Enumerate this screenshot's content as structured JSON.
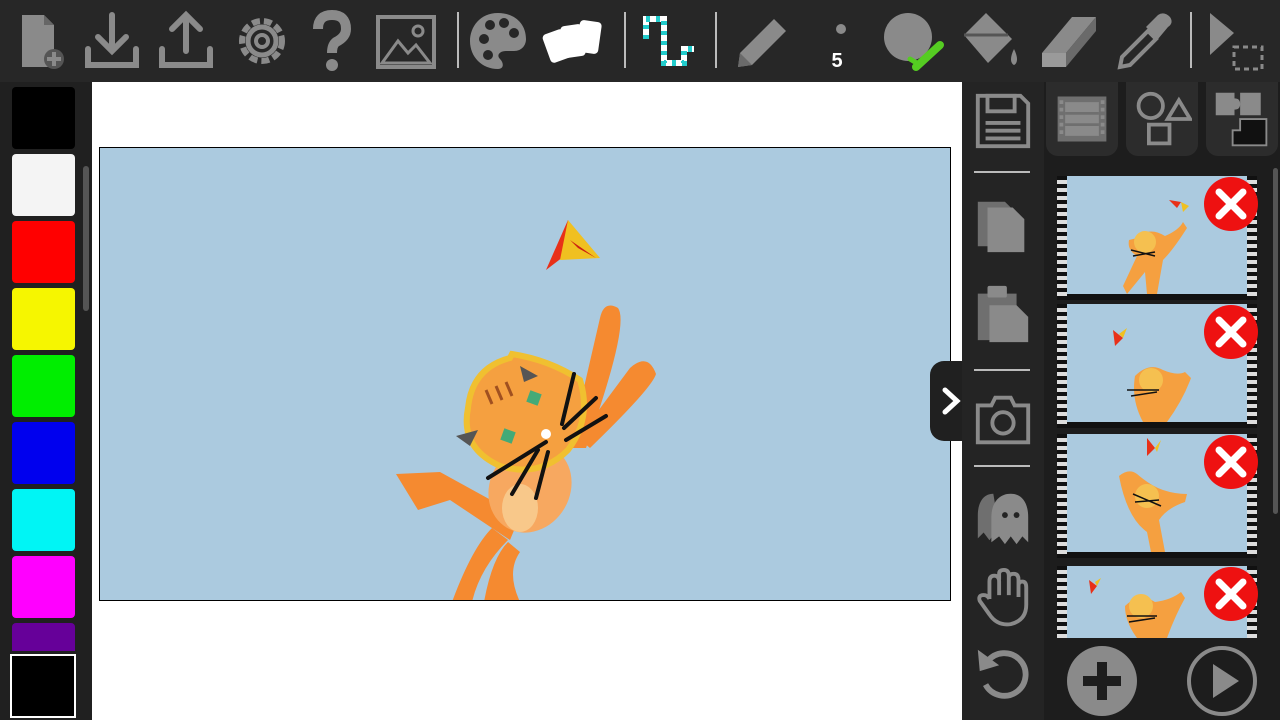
{
  "toolbar": {
    "buttons": [
      {
        "name": "new-file",
        "icon": "new-file-icon"
      },
      {
        "name": "download",
        "icon": "download-icon"
      },
      {
        "name": "upload",
        "icon": "upload-icon"
      },
      {
        "name": "settings",
        "icon": "gear-icon"
      },
      {
        "name": "help",
        "icon": "help-icon"
      },
      {
        "name": "image",
        "icon": "image-icon"
      },
      {
        "name": "palette",
        "icon": "palette-icon"
      },
      {
        "name": "cards",
        "icon": "cards-icon"
      },
      {
        "name": "line-style",
        "icon": "squiggle-icon"
      },
      {
        "name": "pencil",
        "icon": "pencil-icon"
      },
      {
        "name": "brush-size",
        "icon": "dot-icon"
      },
      {
        "name": "fill-brush",
        "icon": "circle-brush-icon"
      },
      {
        "name": "paint-bucket",
        "icon": "bucket-icon"
      },
      {
        "name": "eraser",
        "icon": "eraser-icon"
      },
      {
        "name": "eyedropper",
        "icon": "eyedropper-icon"
      },
      {
        "name": "select",
        "icon": "select-icon"
      }
    ],
    "brush_size": "5"
  },
  "palette": {
    "swatches": [
      "#000000",
      "#f4f4f4",
      "#ff0000",
      "#f6f600",
      "#00ee00",
      "#0000ee",
      "#00f5f5",
      "#ff00ff",
      "#660099"
    ],
    "current_color": "#000000"
  },
  "side_tools": [
    "save-icon",
    "copy-icon",
    "paste-icon",
    "camera-icon",
    "ghost-icon",
    "hand-icon",
    "undo-icon"
  ],
  "panel_tabs": [
    "film-icon",
    "shapes-icon",
    "puzzle-icon"
  ],
  "frames": [
    {
      "index": 1
    },
    {
      "index": 2
    },
    {
      "index": 3
    },
    {
      "index": 4
    }
  ],
  "colors": {
    "stage_bg": "#abcadf",
    "cat": "#f5a050",
    "delete_red": "#ee1111"
  }
}
